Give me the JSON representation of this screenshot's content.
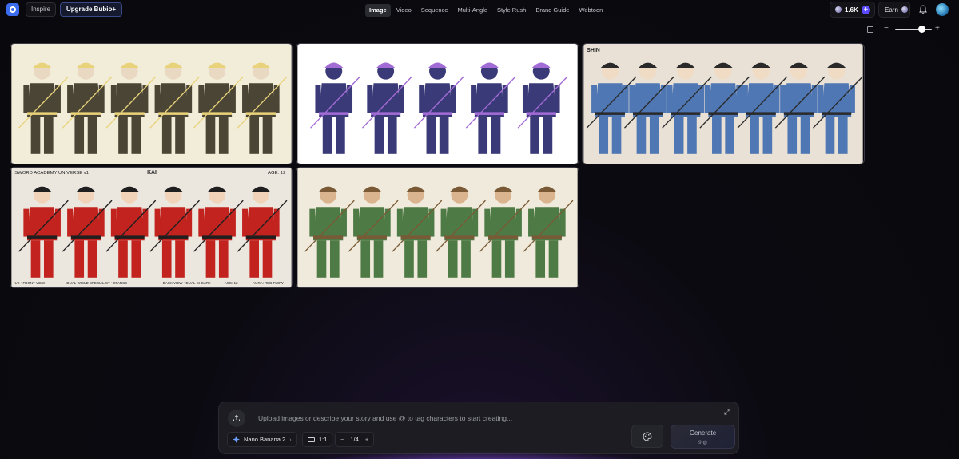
{
  "header": {
    "inspire_label": "Inspire",
    "upgrade_label": "Upgrade Bubio+",
    "tabs": [
      {
        "label": "Image",
        "active": true
      },
      {
        "label": "Video",
        "active": false
      },
      {
        "label": "Sequence",
        "active": false
      },
      {
        "label": "Multi-Angle",
        "active": false
      },
      {
        "label": "Style Rush",
        "active": false
      },
      {
        "label": "Brand Guide",
        "active": false
      },
      {
        "label": "Webtoon",
        "active": false
      }
    ],
    "credits": "1.6K",
    "earn_label": "Earn"
  },
  "toolbar": {
    "zoom_level": 0.72
  },
  "gallery": {
    "cards": [
      {
        "id": "card1",
        "palette": {
          "bg": "#f3f2ee",
          "fig": "#4b4536",
          "accent": "#e8d27a"
        },
        "caption": ""
      },
      {
        "id": "card2",
        "palette": {
          "bg": "#ffffff",
          "fig": "#3b3a78",
          "accent": "#a36bd6"
        },
        "caption": ""
      },
      {
        "id": "card3",
        "palette": {
          "bg": "#e9e1d6",
          "fig": "#4f77b3",
          "accent": "#2a2a2a"
        },
        "caption": "SHIN"
      },
      {
        "id": "card4",
        "palette": {
          "bg": "#ebe7df",
          "fig": "#c2231f",
          "accent": "#1f1f1f"
        },
        "header_left": "SWORD ACADEMY UNIVERSE v1",
        "header_center": "KAI",
        "header_right": "AGE: 12",
        "footer": [
          "KAI • FRONT VIEW",
          "DUAL-WIELD SPECIALIST • STANCE",
          "BACK VIEW • DUAL-SHEATH",
          "AGE: 12",
          "AURA: RED FLOW"
        ]
      },
      {
        "id": "card5",
        "palette": {
          "bg": "#efeadb",
          "fig": "#4e7a45",
          "accent": "#7a5a36"
        },
        "caption": ""
      }
    ]
  },
  "composer": {
    "placeholder": "Upload images or describe your story and use @ to tag characters to start creating...",
    "model": "Nano Banana 2",
    "aspect_ratio": "1:1",
    "count": "1/4",
    "generate_label": "Generate",
    "generate_cost": "9"
  },
  "colors": {
    "accent": "#5b4dff",
    "background": "#0b0a10"
  }
}
